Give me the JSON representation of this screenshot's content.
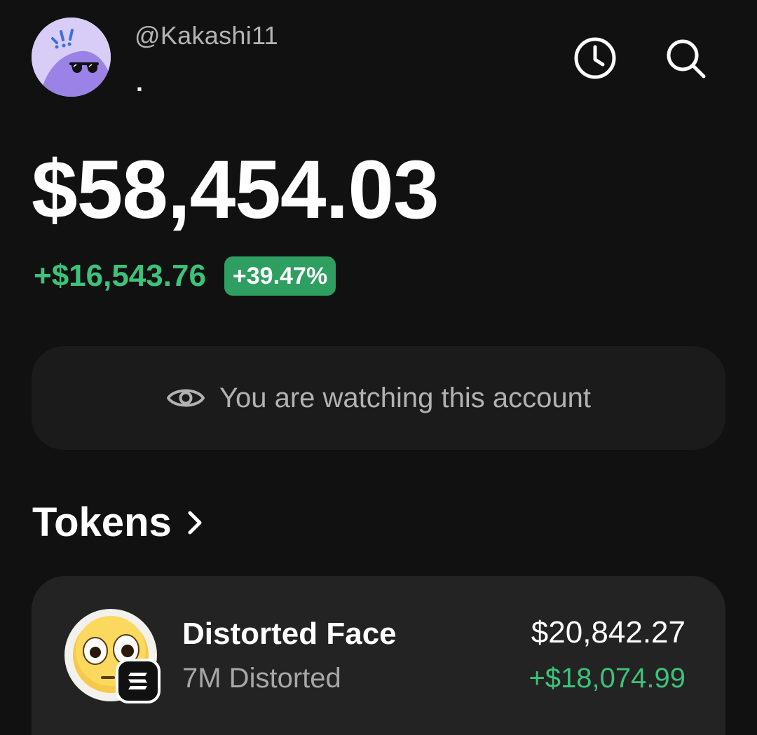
{
  "profile": {
    "username": "@Kakashi11",
    "subtitle": "."
  },
  "header_actions": [
    {
      "icon": "clock-icon",
      "label": "history"
    },
    {
      "icon": "search-icon",
      "label": "search"
    }
  ],
  "balance": {
    "total": "$58,454.03",
    "change_amount": "+$16,543.76",
    "change_percent": "+39.47%"
  },
  "watch_banner": {
    "icon": "eye-icon",
    "text": "You are watching this account"
  },
  "tokens": {
    "title": "Tokens",
    "items": [
      {
        "name": "Distorted Face",
        "amount": "7M Distorted",
        "value": "$20,842.27",
        "change": "+$18,074.99",
        "icon": "flushed-face-icon",
        "chain_badge": "solana-icon"
      }
    ]
  },
  "colors": {
    "background": "#111111",
    "card": "#232323",
    "banner": "#1b1b1b",
    "positive": "#3cc27a",
    "badge": "#2f9e61",
    "avatar_bg": "#d8cdf6",
    "avatar_figure": "#9a82e6"
  }
}
